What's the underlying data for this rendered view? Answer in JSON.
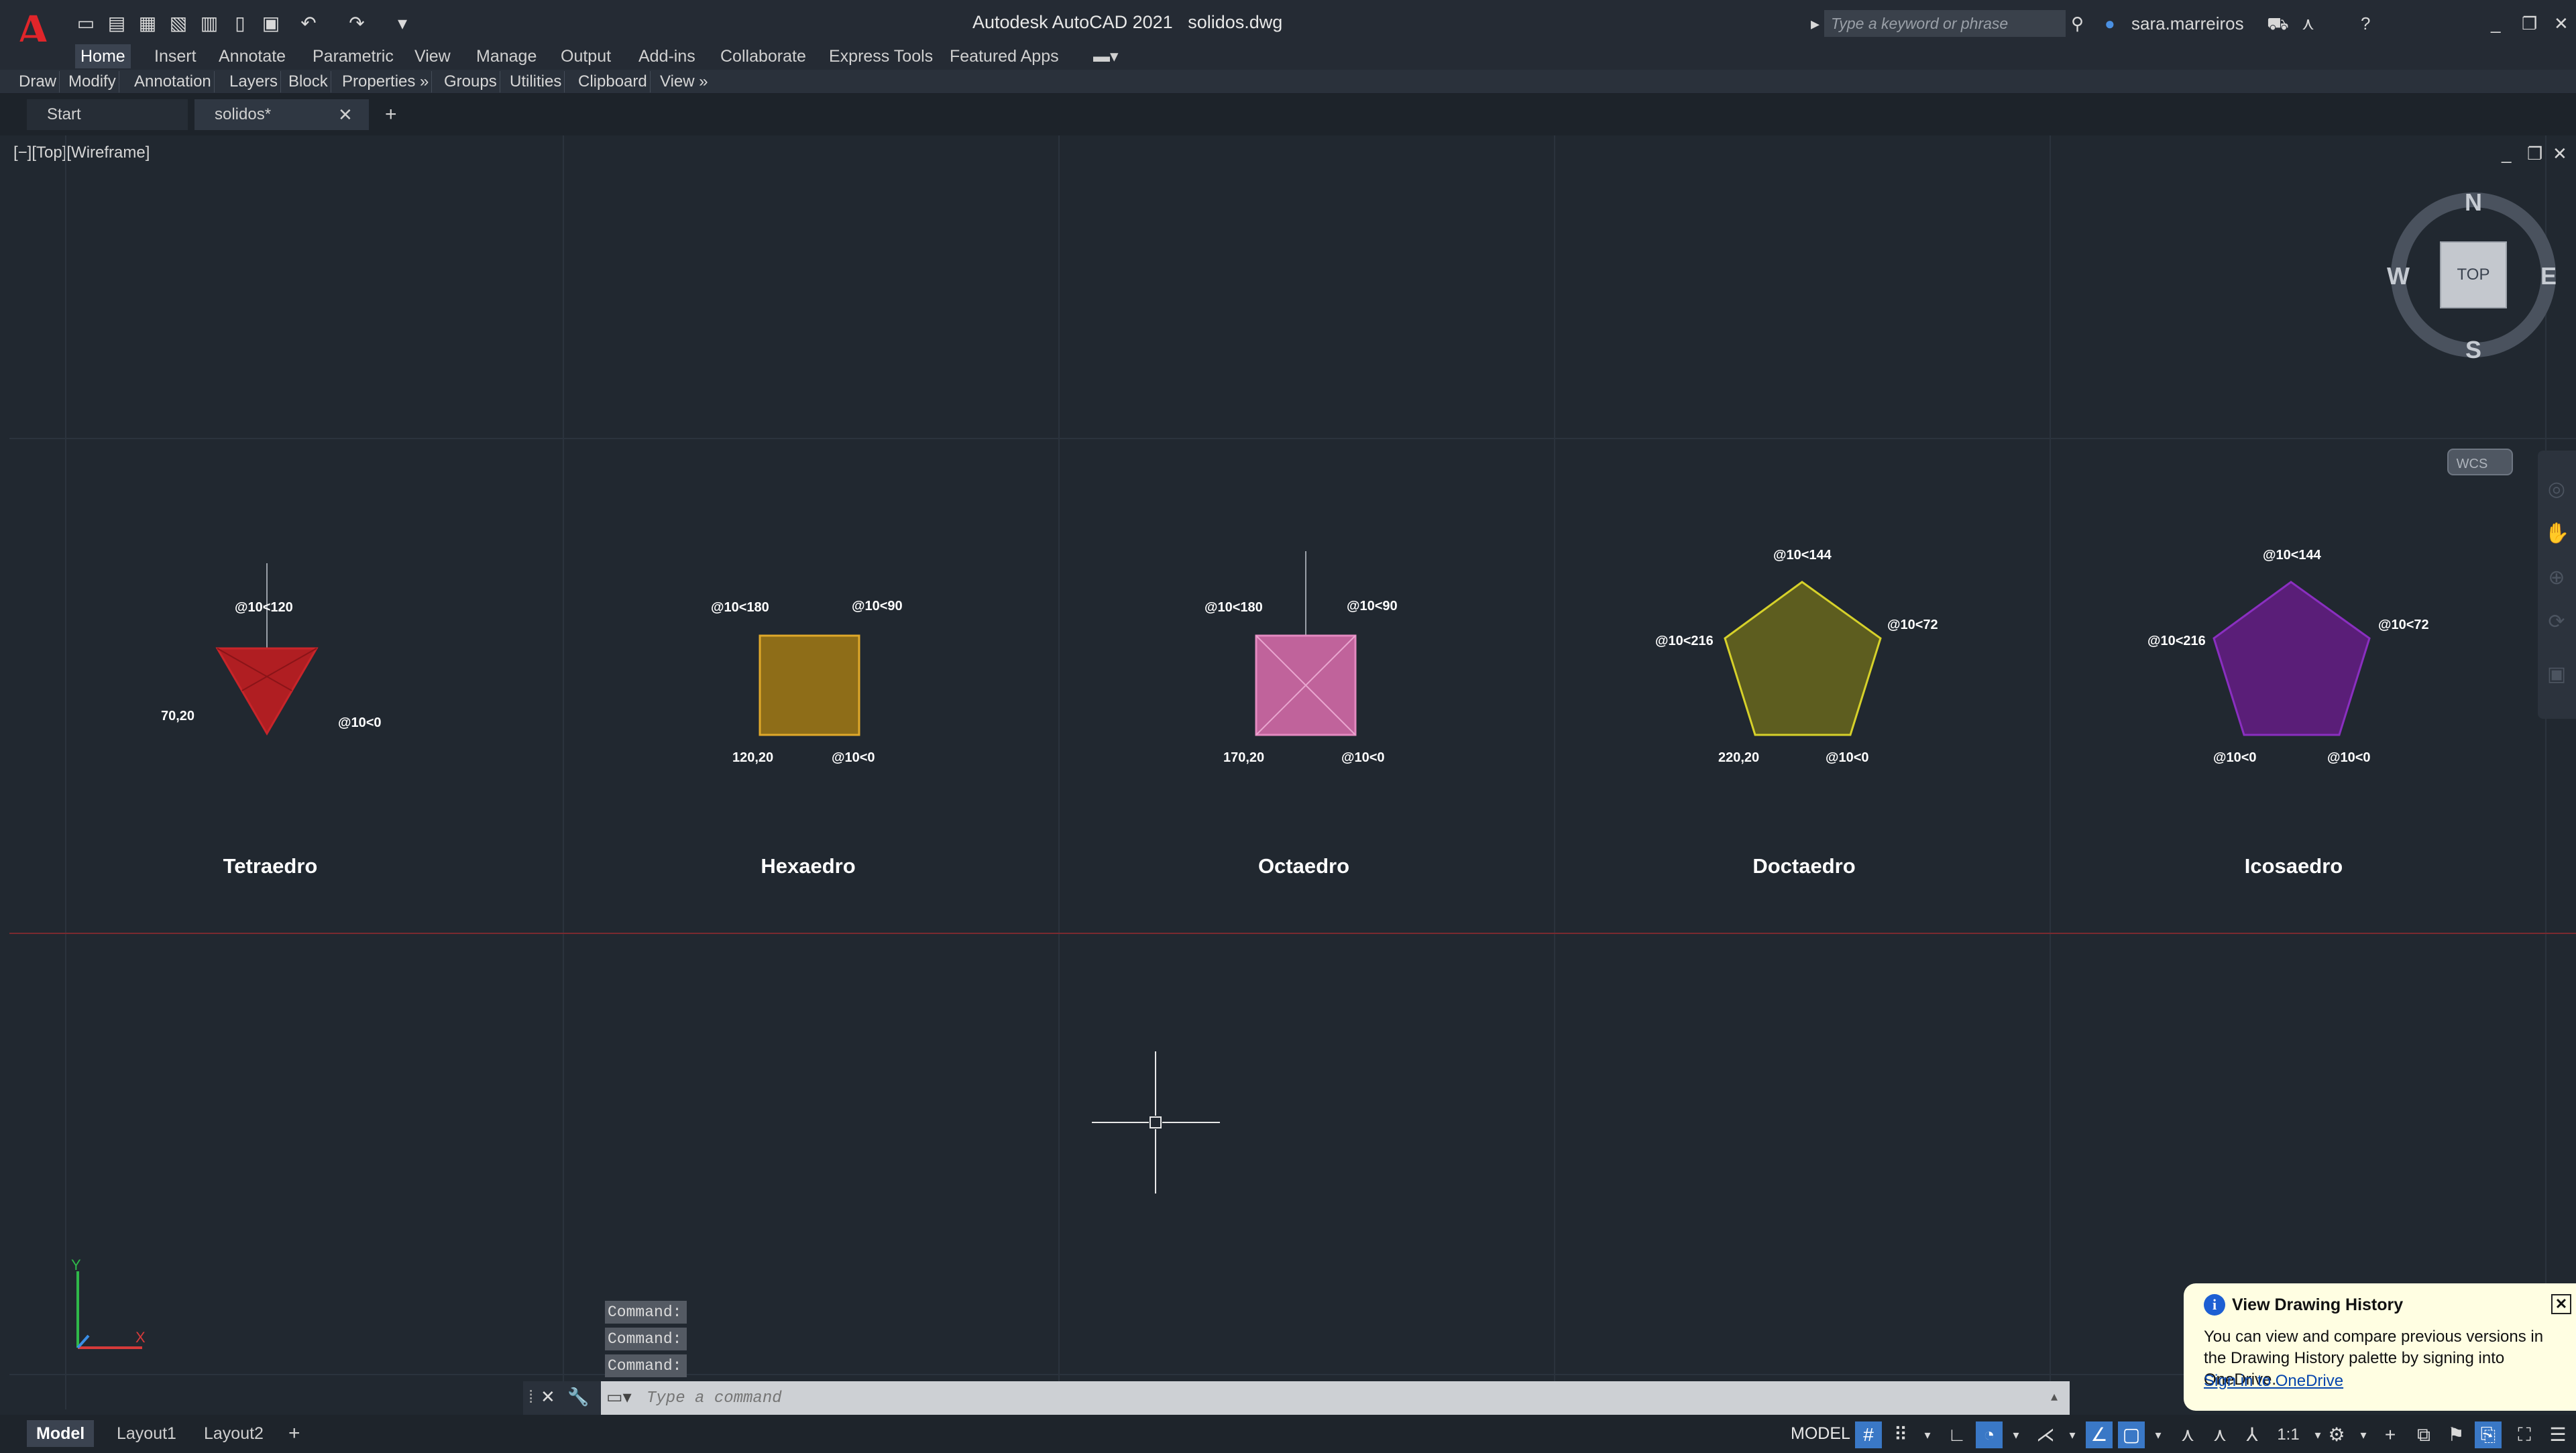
{
  "app": {
    "logo": "A",
    "title": "Autodesk AutoCAD 2021",
    "document": "solidos.dwg"
  },
  "search": {
    "placeholder": "Type a keyword or phrase"
  },
  "user": {
    "name": "sara.marreiros"
  },
  "ribbon": {
    "tabs": [
      "Home",
      "Insert",
      "Annotate",
      "Parametric",
      "View",
      "Manage",
      "Output",
      "Add-ins",
      "Collaborate",
      "Express Tools",
      "Featured Apps"
    ],
    "active_tab": "Home",
    "panels": [
      "Draw",
      "Modify",
      "Annotation",
      "Layers",
      "Block",
      "Properties »",
      "Groups",
      "Utilities",
      "Clipboard",
      "View »"
    ]
  },
  "doc_tabs": {
    "start": "Start",
    "current": "solidos*"
  },
  "viewport": {
    "label": "[−][Top][Wireframe]"
  },
  "viewcube": {
    "north": "N",
    "south": "S",
    "east": "E",
    "west": "W",
    "face": "TOP",
    "wcs": "WCS"
  },
  "drawing": {
    "tetraedro": {
      "name": "Tetraedro",
      "dim_top": "@10<120",
      "point": "70,20",
      "dim_right": "@10<0"
    },
    "hexaedro": {
      "name": "Hexaedro",
      "dim_left": "@10<180",
      "dim_right": "@10<90",
      "point": "120,20",
      "dim_bottom": "@10<0"
    },
    "octaedro": {
      "name": "Octaedro",
      "dim_left": "@10<180",
      "dim_right": "@10<90",
      "point": "170,20",
      "dim_bottom": "@10<0"
    },
    "doctaedro": {
      "name": "Doctaedro",
      "dim_top": "@10<144",
      "dim_left": "@10<216",
      "dim_right": "@10<72",
      "point": "220,20",
      "dim_bottom": "@10<0"
    },
    "icosaedro": {
      "name": "Icosaedro",
      "dim_top": "@10<144",
      "dim_left": "@10<216",
      "dim_right": "@10<72",
      "dim_bottom_left": "@10<0",
      "dim_bottom_right": "@10<0"
    }
  },
  "command": {
    "history": [
      "Command:",
      "Command:",
      "Command:"
    ],
    "placeholder": "Type a command"
  },
  "layouts": [
    "Model",
    "Layout1",
    "Layout2"
  ],
  "status": {
    "model": "MODEL",
    "scale": "1:1"
  },
  "balloon": {
    "title": "View Drawing History",
    "body": "You can view and compare previous versions in the Drawing History palette by signing into OneDrive.",
    "link": "Sign in to OneDrive"
  },
  "colors": {
    "tetraedro": "#b01e22",
    "hexaedro": "#c8961e",
    "octaedro": "#e07bb7",
    "doctaedro": "#5d5d1f",
    "icosaedro": "#6e1f8c",
    "background": "#212830"
  }
}
